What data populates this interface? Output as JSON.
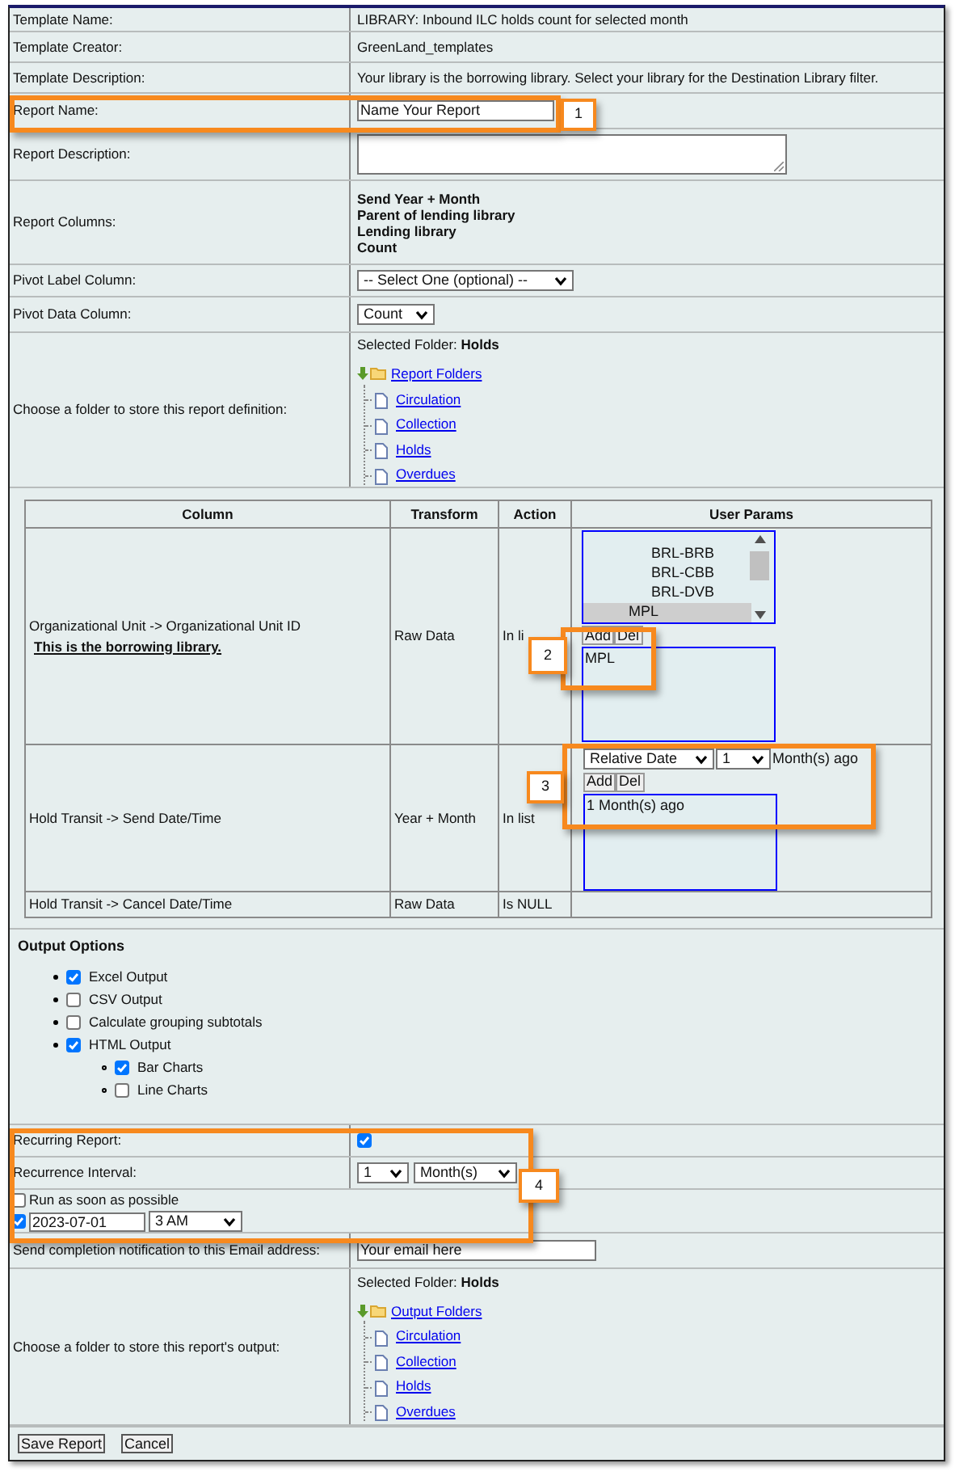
{
  "template_info": [
    {
      "label": "Template Name:",
      "value": "LIBRARY: Inbound ILC holds count for selected month"
    },
    {
      "label": "Template Creator:",
      "value": "GreenLand_templates"
    },
    {
      "label": "Template Description:",
      "value": "Your library is the borrowing library. Select your library for the Destination Library filter."
    }
  ],
  "report_name": {
    "label": "Report Name:",
    "value": "Name Your Report"
  },
  "report_description": {
    "label": "Report Description:"
  },
  "report_columns": {
    "label": "Report Columns:",
    "items": [
      "Send Year + Month",
      "Parent of lending library",
      "Lending library",
      "Count"
    ]
  },
  "pivot_label": {
    "label": "Pivot Label Column:",
    "value": "-- Select One (optional) --"
  },
  "pivot_data": {
    "label": "Pivot Data Column:",
    "value": "Count"
  },
  "definition_folder": {
    "label": "Choose a folder to store this report definition:",
    "selected_prefix": "Selected Folder:",
    "selected": "Holds",
    "root": "Report Folders",
    "children": [
      "Circulation",
      "Collection",
      "Holds",
      "Overdues"
    ]
  },
  "params_table": {
    "columns": [
      "Column",
      "Transform",
      "Action",
      "User Params"
    ],
    "rows": [
      {
        "kind": "org",
        "column": "Organizational Unit -> Organizational Unit ID",
        "note": "This is the borrowing library.",
        "transform": "Raw Data",
        "action": "In li",
        "options": [
          {
            "label": "BRL-BRB",
            "selected": false
          },
          {
            "label": "BRL-CBB",
            "selected": false
          },
          {
            "label": "BRL-DVB",
            "selected": false
          },
          {
            "label": "MPL",
            "selected": true
          }
        ],
        "add": "Add",
        "del": "Del",
        "values": [
          "MPL"
        ]
      },
      {
        "kind": "date",
        "column": "Hold Transit -> Send Date/Time",
        "transform": "Year + Month",
        "action": "In list",
        "date_type": "Relative Date",
        "amount": "1",
        "suffix": "Month(s) ago",
        "add": "Add",
        "del": "Del",
        "values": [
          "1 Month(s) ago"
        ]
      },
      {
        "kind": "plain",
        "column": "Hold Transit -> Cancel Date/Time",
        "transform": "Raw Data",
        "action": "Is NULL"
      }
    ]
  },
  "output_options": {
    "title": "Output Options",
    "items": [
      {
        "label": "Excel Output",
        "checked": true
      },
      {
        "label": "CSV Output",
        "checked": false
      },
      {
        "label": "Calculate grouping subtotals",
        "checked": false
      },
      {
        "label": "HTML Output",
        "checked": true,
        "children": [
          {
            "label": "Bar Charts",
            "checked": true
          },
          {
            "label": "Line Charts",
            "checked": false
          }
        ]
      }
    ]
  },
  "recurring": {
    "label": "Recurring Report:",
    "checked": true
  },
  "recurrence_interval": {
    "label": "Recurrence Interval:",
    "amount": "1",
    "unit": "Month(s)"
  },
  "run_asap": {
    "label": "Run as soon as possible",
    "checked": false
  },
  "schedule": {
    "checked": true,
    "date": "2023-07-01",
    "time": "3 AM"
  },
  "email": {
    "label": "Send completion notification to this Email address:",
    "value": "Your email here"
  },
  "output_folder": {
    "label": "Choose a folder to store this report's output:",
    "selected_prefix": "Selected Folder:",
    "selected": "Holds",
    "root": "Output Folders",
    "children": [
      "Circulation",
      "Collection",
      "Holds",
      "Overdues"
    ]
  },
  "buttons": [
    "Save Report",
    "Cancel"
  ],
  "callouts": [
    "1",
    "2",
    "3",
    "4"
  ]
}
